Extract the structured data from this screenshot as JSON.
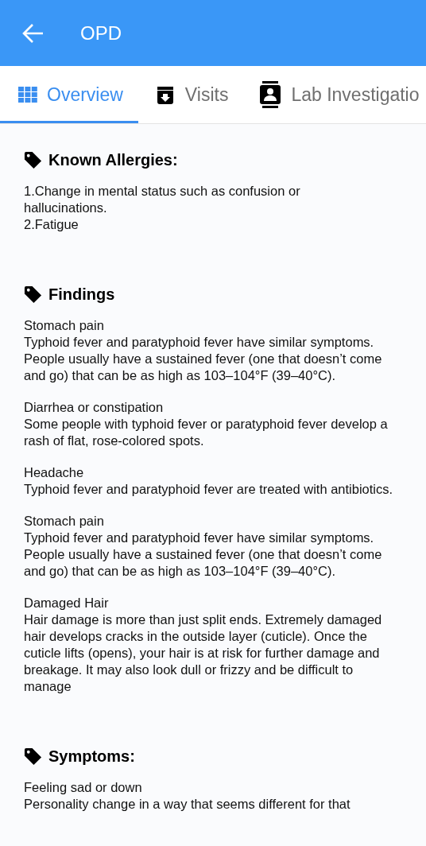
{
  "app_bar": {
    "title": "OPD"
  },
  "tabs": [
    {
      "label": "Overview",
      "selected": true,
      "kind": "grid"
    },
    {
      "label": "Visits",
      "selected": false,
      "kind": "archive"
    },
    {
      "label": "Lab Investigatio",
      "selected": false,
      "kind": "contact"
    }
  ],
  "sections": [
    {
      "heading": "Known Allergies:",
      "entries": [
        {
          "lines": [
            "1.Change in mental status such as confusion or hallucinations.",
            "2.Fatigue"
          ]
        }
      ]
    },
    {
      "heading": "Findings",
      "entries": [
        {
          "title": "Stomach pain",
          "text": "Typhoid fever and paratyphoid fever have similar symptoms. People usually have a sustained fever (one that doesn’t come and go) that can be as high as 103–104°F (39–40°C)."
        },
        {
          "title": "Diarrhea or constipation",
          "text": "Some people with typhoid fever or paratyphoid fever develop a rash of flat, rose-colored spots."
        },
        {
          "title": "Headache",
          "text": "Typhoid fever and paratyphoid fever are treated with antibiotics."
        },
        {
          "title": "Stomach pain",
          "text": "Typhoid fever and paratyphoid fever have similar symptoms. People usually have a sustained fever (one that doesn’t come and go) that can be as high as 103–104°F (39–40°C)."
        },
        {
          "title": "Damaged Hair",
          "text": "Hair damage is more than just split ends. Extremely damaged hair develops cracks in the outside layer (cuticle). Once the cuticle lifts (opens), your hair is at risk for further damage and breakage. It may also look dull or frizzy and be difficult to manage"
        }
      ]
    },
    {
      "heading": "Symptoms:",
      "entries": [
        {
          "title": "Feeling sad or down",
          "text": "Personality change in a way that seems different for that"
        }
      ]
    }
  ]
}
